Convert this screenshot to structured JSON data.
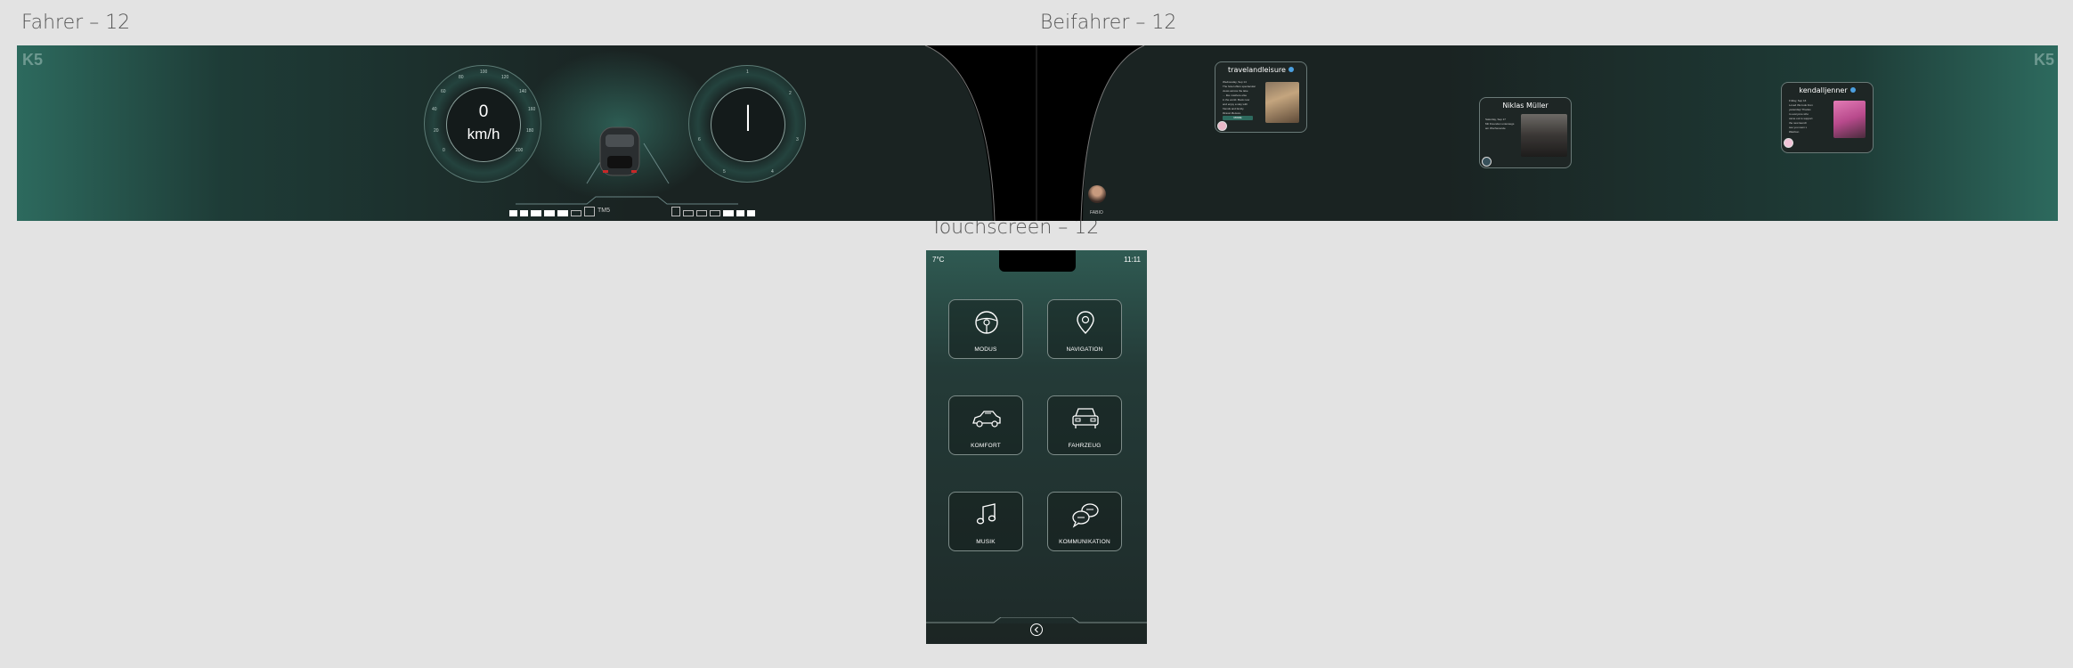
{
  "labels": {
    "fahrer": "Fahrer – 12",
    "beifahrer": "Beifahrer – 12",
    "touchscreen": "Touchscreen – 12"
  },
  "cluster": {
    "logo": "K5",
    "speed": {
      "value": "0",
      "unit": "km/h",
      "ticks": [
        "0",
        "20",
        "40",
        "60",
        "80",
        "100",
        "120",
        "140",
        "160",
        "180",
        "200"
      ]
    },
    "gear": {
      "value": "I",
      "ticks": [
        "1",
        "2",
        "3",
        "4",
        "5",
        "6"
      ]
    },
    "range_label": "TM5",
    "driver_avatar_label": "FABIO",
    "cards": [
      {
        "title": "travelandleisure",
        "verified": true,
        "text": [
          "Wednesday, Sep 14",
          "The hotel offers spectacular",
          "views across the lake",
          "… like nowhere else",
          "in the world. Book now",
          "and enjoy a stay with",
          "friends and family.",
          "#travel #leisure"
        ],
        "button": "MORE"
      },
      {
        "title": "Niklas Müller",
        "verified": false,
        "text": [
          "Saturday, Sep 17",
          "Mit Freunden unterwegs",
          "am Wochenende"
        ]
      },
      {
        "title": "kendalljenner",
        "verified": true,
        "text": [
          "Friday, Sep 16",
          "Loved this look from",
          "yesterday! Thanks",
          "to everyone who",
          "came out to support",
          "the new launch",
          "see you soon x",
          "#fashion"
        ]
      }
    ]
  },
  "touch": {
    "temp": "7°C",
    "time": "11:11",
    "tiles": [
      {
        "label": "MODUS",
        "icon": "steering-wheel-icon"
      },
      {
        "label": "NAVIGATION",
        "icon": "map-pin-icon"
      },
      {
        "label": "KOMFORT",
        "icon": "car-seat-comfort-icon"
      },
      {
        "label": "FAHRZEUG",
        "icon": "vehicle-icon"
      },
      {
        "label": "MUSIK",
        "icon": "music-note-icon"
      },
      {
        "label": "KOMMUNIKATION",
        "icon": "chat-bubbles-icon"
      }
    ],
    "back_icon": "chevron-left-icon"
  },
  "colors": {
    "teal_accent": "#2d6a5e",
    "panel_dark": "#1a2322",
    "verified_blue": "#4b9fe0"
  }
}
